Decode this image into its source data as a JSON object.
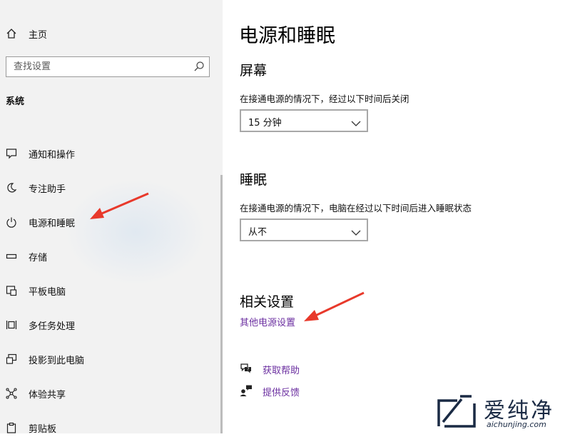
{
  "sidebar": {
    "home_label": "主页",
    "search_placeholder": "查找设置",
    "section_title": "系统",
    "items": [
      {
        "label": "通知和操作",
        "icon": "notification-icon"
      },
      {
        "label": "专注助手",
        "icon": "moon-icon"
      },
      {
        "label": "电源和睡眠",
        "icon": "power-icon"
      },
      {
        "label": "存储",
        "icon": "storage-icon"
      },
      {
        "label": "平板电脑",
        "icon": "tablet-icon"
      },
      {
        "label": "多任务处理",
        "icon": "multitask-icon"
      },
      {
        "label": "投影到此电脑",
        "icon": "project-icon"
      },
      {
        "label": "体验共享",
        "icon": "share-icon"
      },
      {
        "label": "剪贴板",
        "icon": "clipboard-icon"
      }
    ]
  },
  "main": {
    "title": "电源和睡眠",
    "screen": {
      "heading": "屏幕",
      "description": "在接通电源的情况下，经过以下时间后关闭",
      "value": "15 分钟"
    },
    "sleep": {
      "heading": "睡眠",
      "description": "在接通电源的情况下，电脑在经过以下时间后进入睡眠状态",
      "value": "从不"
    },
    "related": {
      "heading": "相关设置",
      "link": "其他电源设置"
    },
    "help": {
      "get_help": "获取帮助",
      "feedback": "提供反馈"
    }
  },
  "watermark": {
    "chinese": "爱纯净",
    "url": "aichunjing.com"
  },
  "colors": {
    "sidebar_bg": "#f2f2f2",
    "link": "#6b2fa0",
    "arrow": "#e8392b"
  }
}
